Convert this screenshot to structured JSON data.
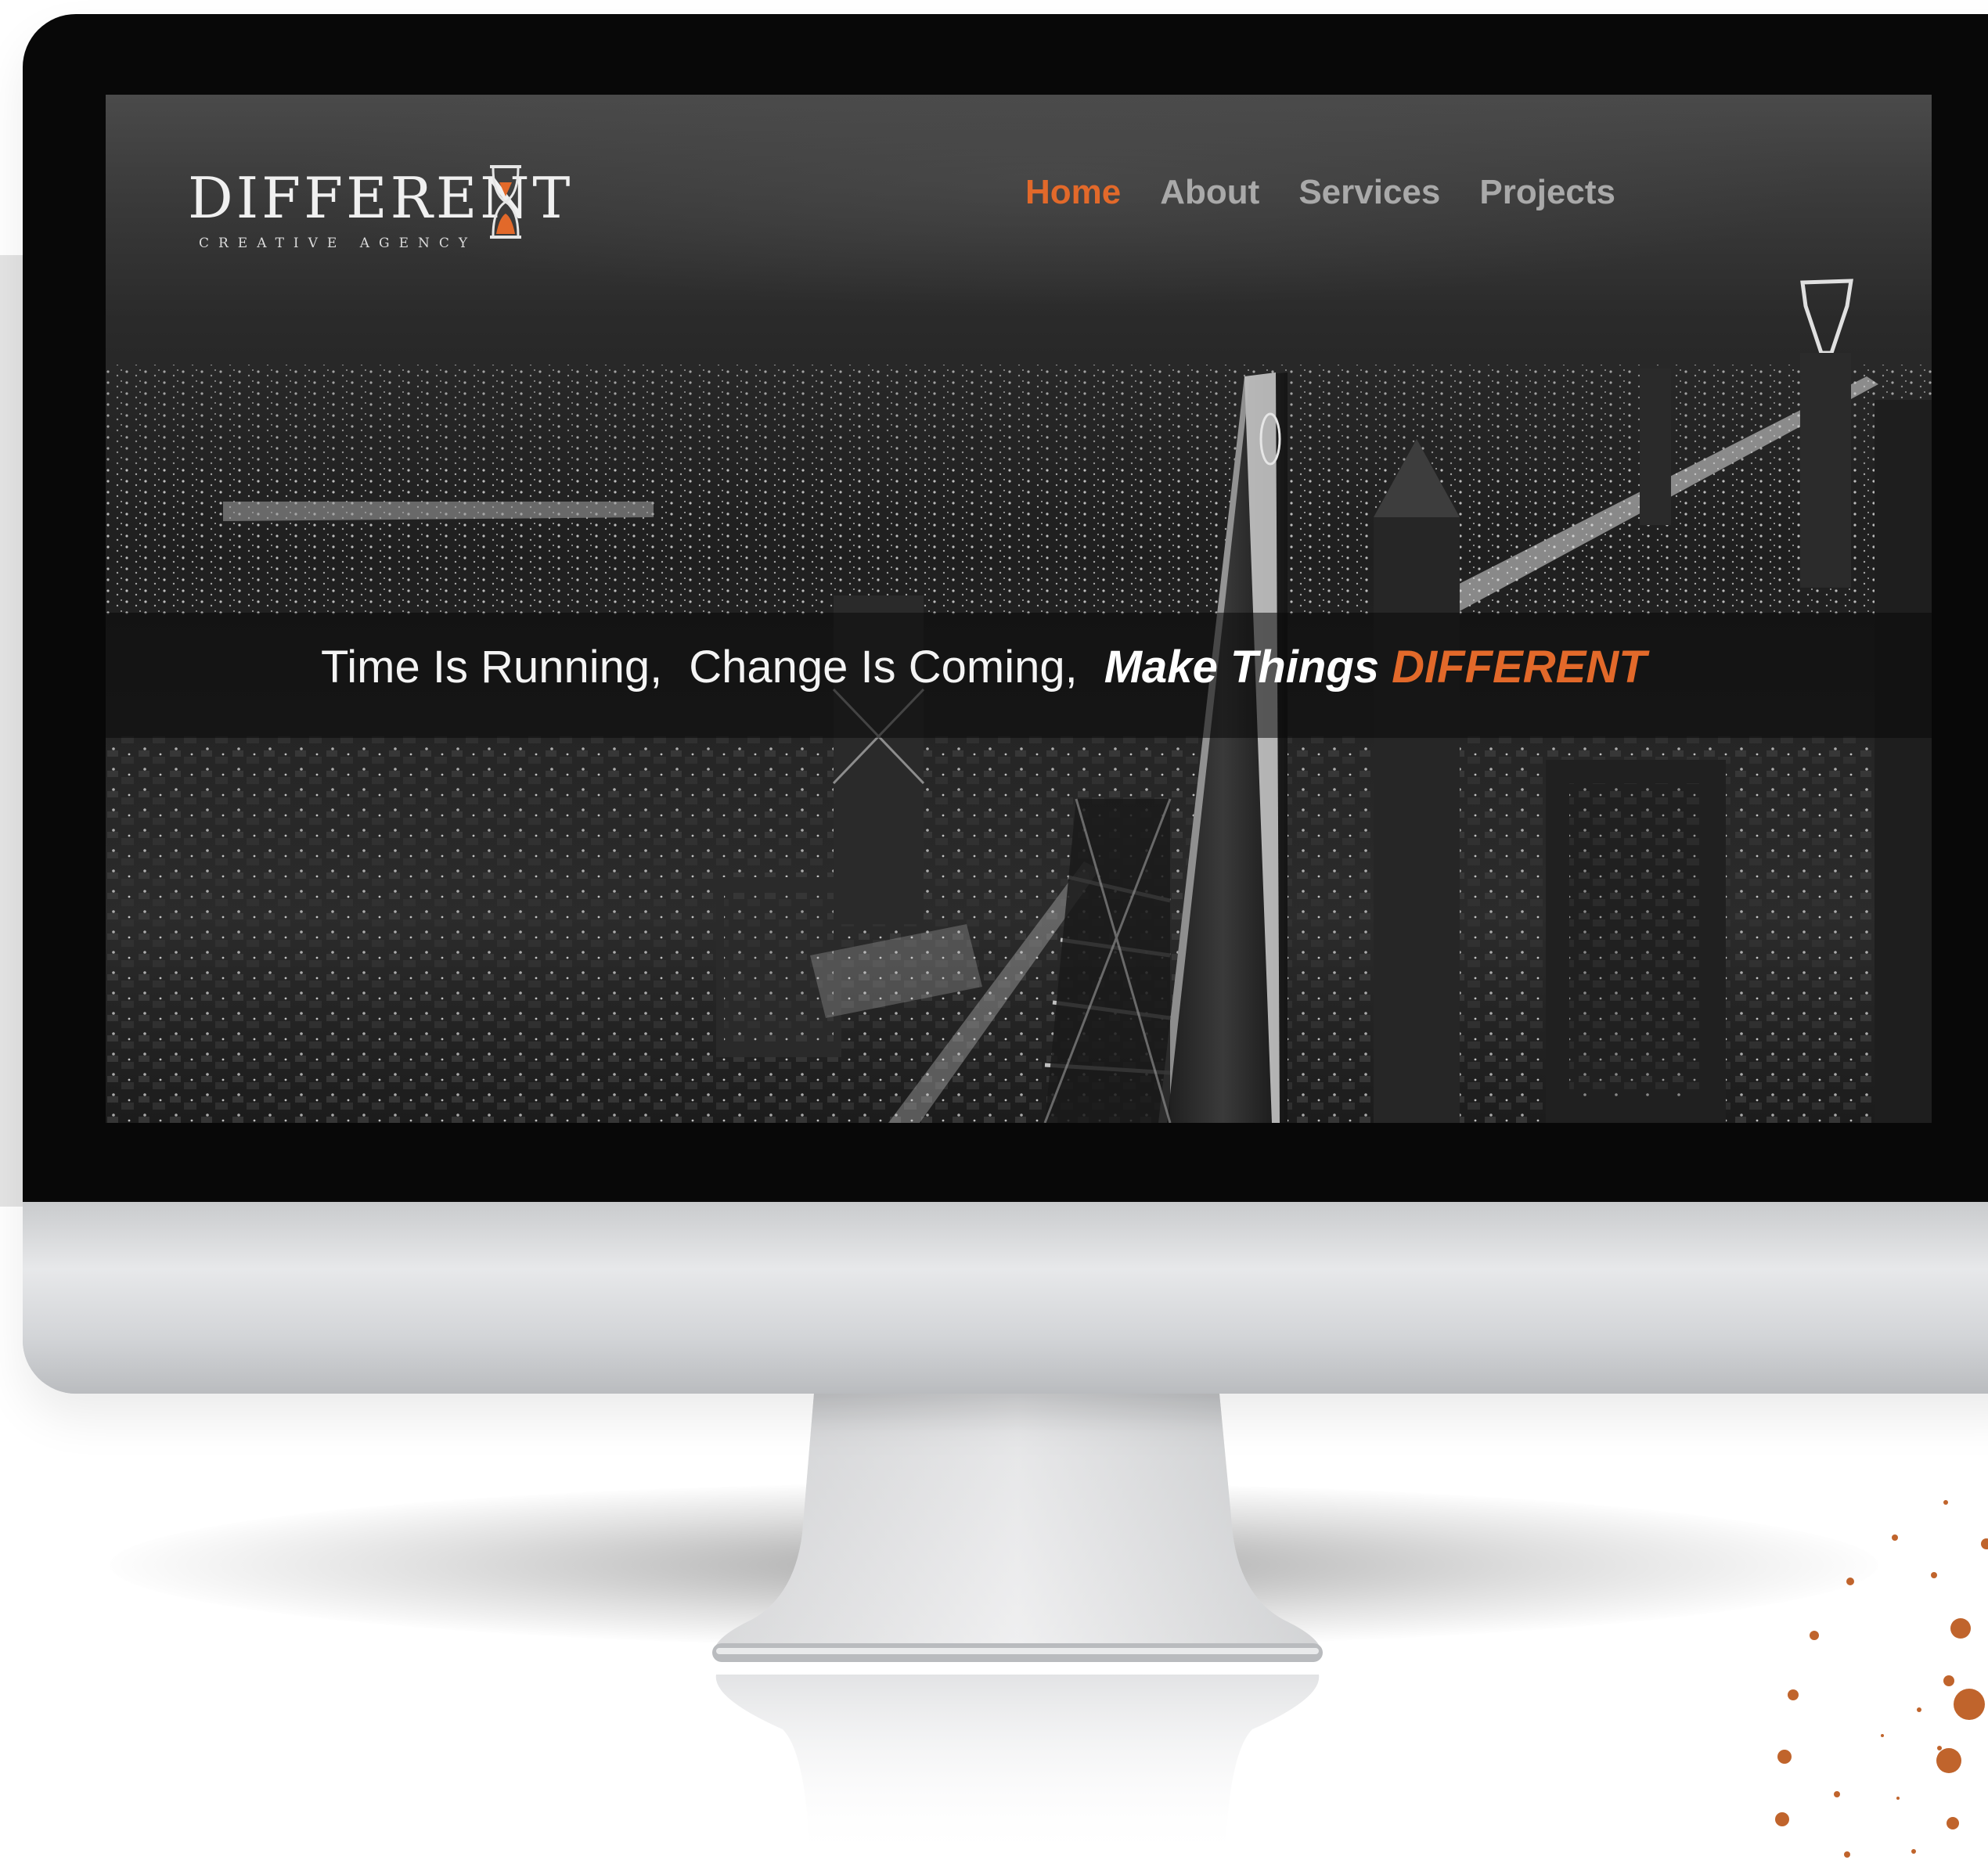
{
  "brand": {
    "logo_text": "DIFFERENT",
    "logo_subtitle": "CREATIVE AGENCY",
    "accent_color": "#e2692a"
  },
  "nav": {
    "items": [
      {
        "label": "Home",
        "active": true
      },
      {
        "label": "About",
        "active": false
      },
      {
        "label": "Services",
        "active": false
      },
      {
        "label": "Projects",
        "active": false
      }
    ]
  },
  "hero": {
    "part1": "Time Is Running,",
    "part2": "Change Is Coming,",
    "part3": "Make Things",
    "part4": "DIFFERENT"
  },
  "icons": {
    "logo_mark": "hourglass-icon"
  }
}
